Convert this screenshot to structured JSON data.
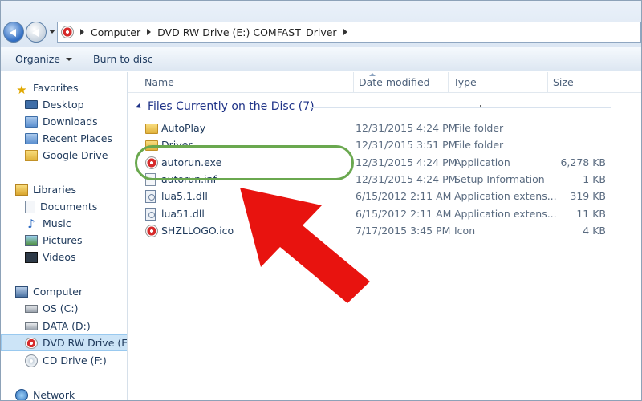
{
  "address": {
    "crumbs": [
      "Computer",
      "DVD RW Drive (E:) COMFAST_Driver"
    ]
  },
  "toolbar": {
    "organize_label": "Organize",
    "burn_label": "Burn to disc"
  },
  "sidebar": {
    "items": [
      {
        "label": "Favorites",
        "icon": "star-icon"
      },
      {
        "label": "Desktop",
        "icon": "desktop-icon"
      },
      {
        "label": "Downloads",
        "icon": "downloads-icon"
      },
      {
        "label": "Recent Places",
        "icon": "recent-places-icon"
      },
      {
        "label": "Google Drive",
        "icon": "google-drive-icon"
      },
      {
        "label": "Libraries",
        "icon": "libraries-icon"
      },
      {
        "label": "Documents",
        "icon": "documents-icon"
      },
      {
        "label": "Music",
        "icon": "music-icon"
      },
      {
        "label": "Pictures",
        "icon": "pictures-icon"
      },
      {
        "label": "Videos",
        "icon": "videos-icon"
      },
      {
        "label": "Computer",
        "icon": "computer-icon"
      },
      {
        "label": "OS (C:)",
        "icon": "disk-icon"
      },
      {
        "label": "DATA (D:)",
        "icon": "disk-icon"
      },
      {
        "label": "DVD RW Drive (E:) C",
        "icon": "dvd-drive-icon"
      },
      {
        "label": "CD Drive (F:)",
        "icon": "cd-drive-icon"
      },
      {
        "label": "Network",
        "icon": "network-icon"
      }
    ]
  },
  "columns": {
    "name": "Name",
    "date": "Date modified",
    "type": "Type",
    "size": "Size"
  },
  "group": {
    "label": "Files Currently on the Disc (7)"
  },
  "files": [
    {
      "name": "AutoPlay",
      "date": "12/31/2015 4:24 PM",
      "type": "File folder",
      "size": ""
    },
    {
      "name": "Driver",
      "date": "12/31/2015 3:51 PM",
      "type": "File folder",
      "size": ""
    },
    {
      "name": "autorun.exe",
      "date": "12/31/2015 4:24 PM",
      "type": "Application",
      "size": "6,278 KB"
    },
    {
      "name": "autorun.inf",
      "date": "12/31/2015 4:24 PM",
      "type": "Setup Information",
      "size": "1 KB"
    },
    {
      "name": "lua5.1.dll",
      "date": "6/15/2012 2:11 AM",
      "type": "Application extens...",
      "size": "319 KB"
    },
    {
      "name": "lua51.dll",
      "date": "6/15/2012 2:11 AM",
      "type": "Application extens...",
      "size": "11 KB"
    },
    {
      "name": "SHZLLOGO.ico",
      "date": "7/17/2015 3:45 PM",
      "type": "Icon",
      "size": "4 KB"
    }
  ],
  "colors": {
    "highlight_ring": "#6aa84f",
    "arrow": "#e8130f",
    "group_header": "#1e3287"
  }
}
